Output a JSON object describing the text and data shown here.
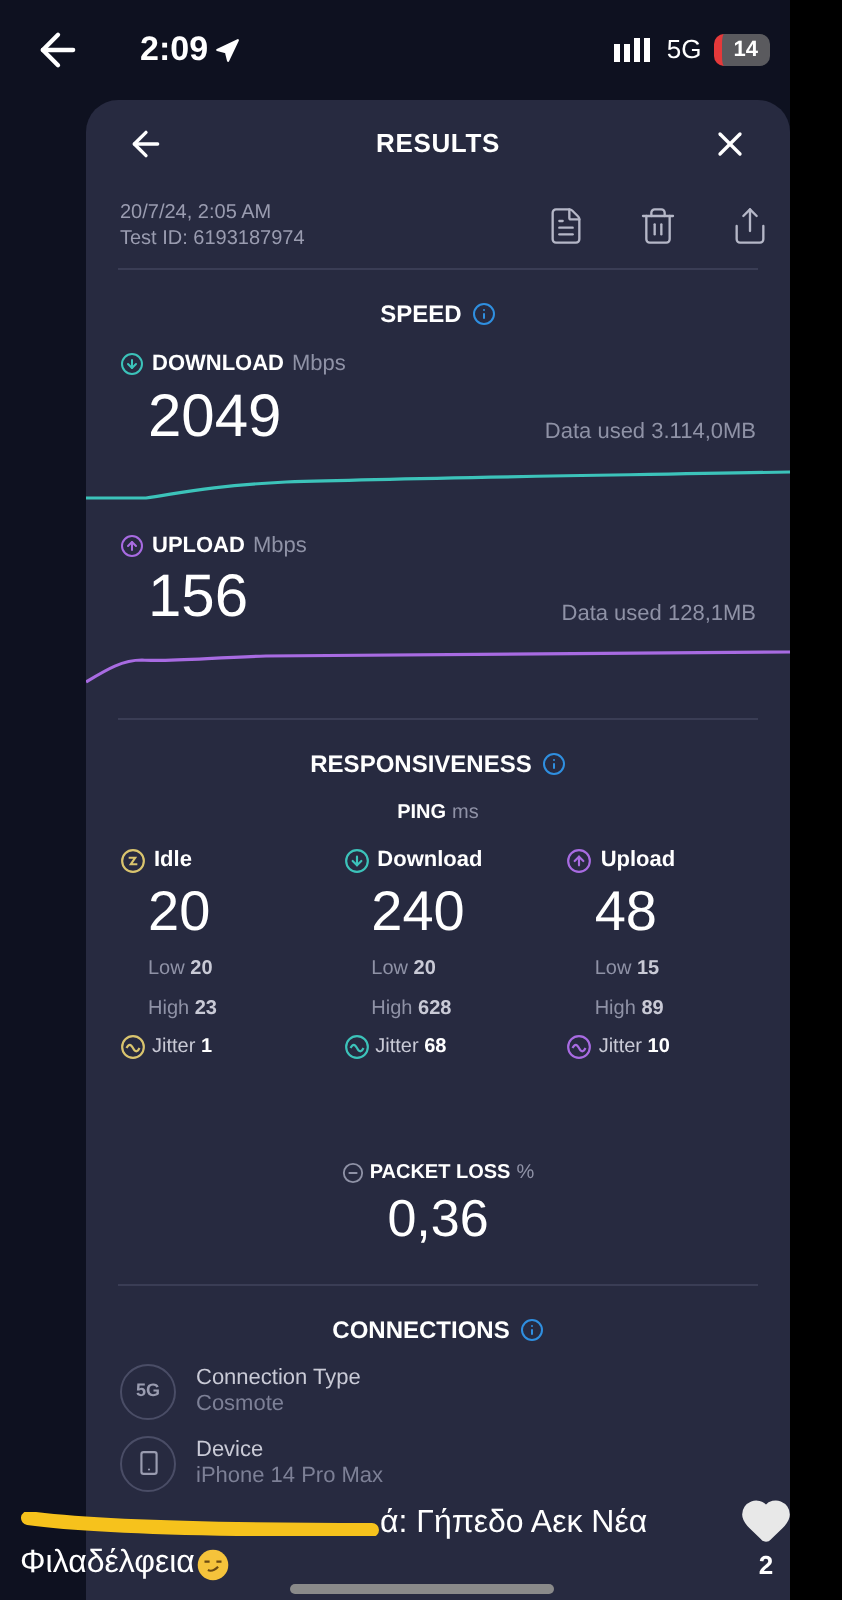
{
  "status_bar": {
    "time": "2:09",
    "network": "5G",
    "battery": "14"
  },
  "header": {
    "title": "RESULTS"
  },
  "test": {
    "date": "20/7/24, 2:05 AM",
    "test_id": "Test ID: 6193187974"
  },
  "speed": {
    "title": "SPEED",
    "items": [
      {
        "kind": "download",
        "label": "DOWNLOAD",
        "unit": "Mbps",
        "value": "2049",
        "data_used": "Data used 3.114,0MB",
        "color": "#3cc3ba"
      },
      {
        "kind": "upload",
        "label": "UPLOAD",
        "unit": "Mbps",
        "value": "156",
        "data_used": "Data used 128,1MB",
        "color": "#a86be2"
      }
    ]
  },
  "responsiveness": {
    "title": "RESPONSIVENESS",
    "ping_label": "PING",
    "ping_unit": "ms",
    "columns": [
      {
        "kind": "idle",
        "label": "Idle",
        "value": "20",
        "low_label": "Low",
        "low": "20",
        "high_label": "High",
        "high": "23",
        "jitter_label": "Jitter",
        "jitter": "1",
        "color": "#d9c46e"
      },
      {
        "kind": "download",
        "label": "Download",
        "value": "240",
        "low_label": "Low",
        "low": "20",
        "high_label": "High",
        "high": "628",
        "jitter_label": "Jitter",
        "jitter": "68",
        "color": "#3cc3ba"
      },
      {
        "kind": "upload",
        "label": "Upload",
        "value": "48",
        "low_label": "Low",
        "low": "15",
        "high_label": "High",
        "high": "89",
        "jitter_label": "Jitter",
        "jitter": "10",
        "color": "#a86be2"
      }
    ]
  },
  "packet_loss": {
    "label": "PACKET LOSS",
    "unit": "%",
    "value": "0,36"
  },
  "connections": {
    "title": "CONNECTIONS",
    "items": [
      {
        "kind": "network",
        "badge": "5G",
        "title": "Connection Type",
        "value": "Cosmote"
      },
      {
        "kind": "device",
        "title": "Device",
        "value": "iPhone 14 Pro Max"
      }
    ]
  },
  "caption": {
    "line1": "ά: Γήπεδο Αεκ Νέα",
    "line2": "Φιλαδέλφεια"
  },
  "likes": {
    "count": "2"
  }
}
